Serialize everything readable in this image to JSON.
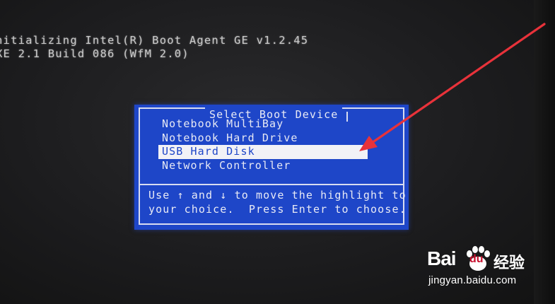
{
  "post": {
    "line1": "nitializing Intel(R) Boot Agent GE v1.2.45",
    "line2": "XE 2.1 Build 086 (WfM 2.0)"
  },
  "boot_menu": {
    "title": "Select Boot Device",
    "items": [
      {
        "label": "Notebook MultiBay",
        "selected": false
      },
      {
        "label": "Notebook Hard Drive",
        "selected": false
      },
      {
        "label": "USB Hard Disk",
        "selected": true
      },
      {
        "label": "Network Controller",
        "selected": false
      }
    ],
    "help_line1": "Use ↑ and ↓ to move the highlight to",
    "help_line2": "your choice.  Press Enter to choose."
  },
  "annotation": {
    "arrow_color": "#e8323a",
    "points_to": "USB Hard Disk"
  },
  "watermark": {
    "brand_bai": "Bai",
    "brand_du": "du",
    "brand_suffix": "经验",
    "url": "jingyan.baidu.com"
  },
  "colors": {
    "dialog_bg": "#1e46c8",
    "dialog_text": "#e6e8f4",
    "highlight_bg": "#f2f2f6",
    "screen_bg": "#1c1c1e"
  }
}
